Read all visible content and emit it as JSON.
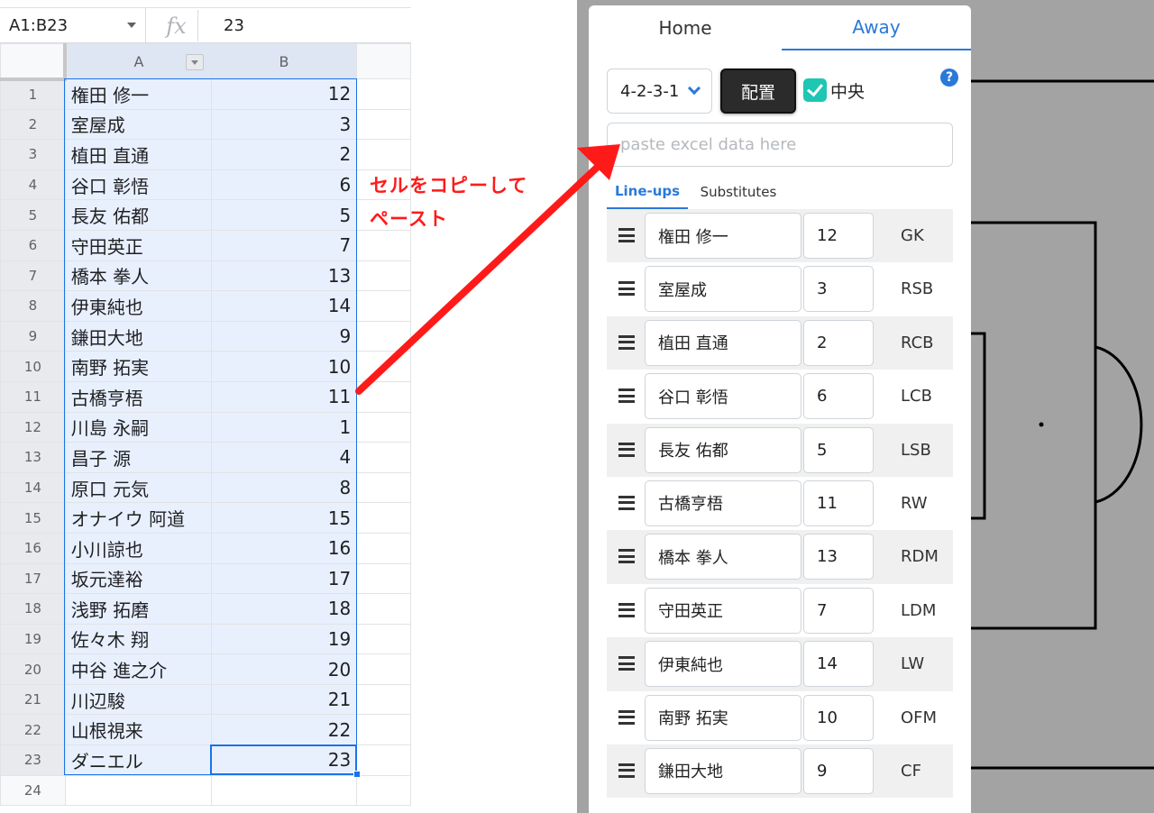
{
  "sheet": {
    "name_box": "A1:B23",
    "fx_label": "fx",
    "formula_value": "23",
    "col_headers": [
      "A",
      "B"
    ],
    "rows": [
      {
        "n": "1",
        "a": "権田 修一",
        "b": "12"
      },
      {
        "n": "2",
        "a": "室屋成",
        "b": "3"
      },
      {
        "n": "3",
        "a": "植田 直通",
        "b": "2"
      },
      {
        "n": "4",
        "a": "谷口 彰悟",
        "b": "6"
      },
      {
        "n": "5",
        "a": "長友 佑都",
        "b": "5"
      },
      {
        "n": "6",
        "a": "守田英正",
        "b": "7"
      },
      {
        "n": "7",
        "a": "橋本 拳人",
        "b": "13"
      },
      {
        "n": "8",
        "a": "伊東純也",
        "b": "14"
      },
      {
        "n": "9",
        "a": "鎌田大地",
        "b": "9"
      },
      {
        "n": "10",
        "a": "南野 拓実",
        "b": "10"
      },
      {
        "n": "11",
        "a": "古橋亨梧",
        "b": "11"
      },
      {
        "n": "12",
        "a": "川島 永嗣",
        "b": "1"
      },
      {
        "n": "13",
        "a": "昌子 源",
        "b": "4"
      },
      {
        "n": "14",
        "a": "原口 元気",
        "b": "8"
      },
      {
        "n": "15",
        "a": "オナイウ 阿道",
        "b": "15"
      },
      {
        "n": "16",
        "a": "小川諒也",
        "b": "16"
      },
      {
        "n": "17",
        "a": "坂元達裕",
        "b": "17"
      },
      {
        "n": "18",
        "a": "浅野 拓磨",
        "b": "18"
      },
      {
        "n": "19",
        "a": "佐々木 翔",
        "b": "19"
      },
      {
        "n": "20",
        "a": "中谷 進之介",
        "b": "20"
      },
      {
        "n": "21",
        "a": "川辺駿",
        "b": "21"
      },
      {
        "n": "22",
        "a": "山根視来",
        "b": "22"
      },
      {
        "n": "23",
        "a": "ダニエル",
        "b": "23"
      },
      {
        "n": "24",
        "a": "",
        "b": ""
      }
    ]
  },
  "annotation": {
    "line1": "セルをコピーして",
    "line2": "ペースト",
    "color": "#ff1a1a"
  },
  "panel": {
    "tabs": {
      "home": "Home",
      "away": "Away"
    },
    "formation": "4-2-3-1",
    "place_button": "配置",
    "center_label": "中央",
    "center_checked": true,
    "help": "?",
    "paste_placeholder": "paste excel data here",
    "subtabs": {
      "lineups": "Line-ups",
      "substitutes": "Substitutes"
    },
    "players": [
      {
        "name": "権田 修一",
        "number": "12",
        "pos": "GK"
      },
      {
        "name": "室屋成",
        "number": "3",
        "pos": "RSB"
      },
      {
        "name": "植田 直通",
        "number": "2",
        "pos": "RCB"
      },
      {
        "name": "谷口 彰悟",
        "number": "6",
        "pos": "LCB"
      },
      {
        "name": "長友 佑都",
        "number": "5",
        "pos": "LSB"
      },
      {
        "name": "古橋亨梧",
        "number": "11",
        "pos": "RW"
      },
      {
        "name": "橋本 拳人",
        "number": "13",
        "pos": "RDM"
      },
      {
        "name": "守田英正",
        "number": "7",
        "pos": "LDM"
      },
      {
        "name": "伊東純也",
        "number": "14",
        "pos": "LW"
      },
      {
        "name": "南野 拓実",
        "number": "10",
        "pos": "OFM"
      },
      {
        "name": "鎌田大地",
        "number": "9",
        "pos": "CF"
      }
    ],
    "accent": "#2a79d8",
    "check_color": "#1ec6b4"
  }
}
